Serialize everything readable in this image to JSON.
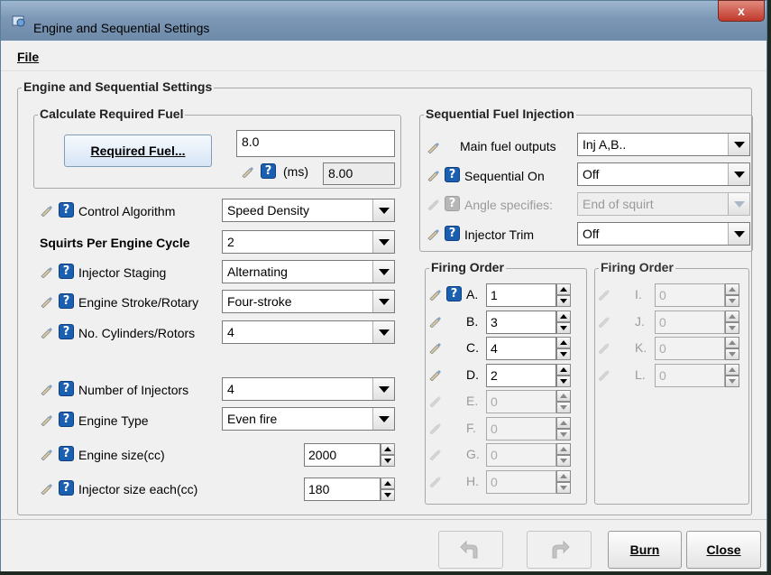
{
  "window": {
    "title": "Engine and Sequential Settings",
    "close_label": "x"
  },
  "menu": {
    "file": "File"
  },
  "main_group": {
    "title": "Engine and Sequential Settings"
  },
  "req_fuel": {
    "title": "Calculate Required Fuel",
    "button": "Required Fuel...",
    "value": "8.0",
    "ms_label": "(ms)",
    "ms_value": "8.00"
  },
  "left": {
    "control_algorithm": {
      "label": "Control Algorithm",
      "value": "Speed Density"
    },
    "squirts": {
      "label": "Squirts Per Engine Cycle",
      "value": "2"
    },
    "injector_staging": {
      "label": "Injector Staging",
      "value": "Alternating"
    },
    "engine_stroke": {
      "label": "Engine Stroke/Rotary",
      "value": "Four-stroke"
    },
    "cylinders": {
      "label": "No. Cylinders/Rotors",
      "value": "4"
    },
    "num_injectors": {
      "label": "Number of Injectors",
      "value": "4"
    },
    "engine_type": {
      "label": "Engine Type",
      "value": "Even fire"
    },
    "engine_size": {
      "label": "Engine size(cc)",
      "value": "2000"
    },
    "injector_size": {
      "label": "Injector size each(cc)",
      "value": "180"
    }
  },
  "sequential": {
    "title": "Sequential Fuel Injection",
    "main_outputs": {
      "label": "Main fuel outputs",
      "value": "Inj A,B.."
    },
    "sequential_on": {
      "label": "Sequential On",
      "value": "Off"
    },
    "angle_specifies": {
      "label": "Angle specifies:",
      "value": "End of squirt"
    },
    "injector_trim": {
      "label": "Injector Trim",
      "value": "Off"
    }
  },
  "firing_order_1": {
    "title": "Firing Order",
    "rows": [
      {
        "label": "A.",
        "value": "1"
      },
      {
        "label": "B.",
        "value": "3"
      },
      {
        "label": "C.",
        "value": "4"
      },
      {
        "label": "D.",
        "value": "2"
      },
      {
        "label": "E.",
        "value": "0"
      },
      {
        "label": "F.",
        "value": "0"
      },
      {
        "label": "G.",
        "value": "0"
      },
      {
        "label": "H.",
        "value": "0"
      }
    ]
  },
  "firing_order_2": {
    "title": "Firing Order",
    "rows": [
      {
        "label": "I.",
        "value": "0"
      },
      {
        "label": "J.",
        "value": "0"
      },
      {
        "label": "K.",
        "value": "0"
      },
      {
        "label": "L.",
        "value": "0"
      }
    ]
  },
  "buttons": {
    "burn": "Burn",
    "close": "Close"
  },
  "icons": {
    "help": "?"
  }
}
